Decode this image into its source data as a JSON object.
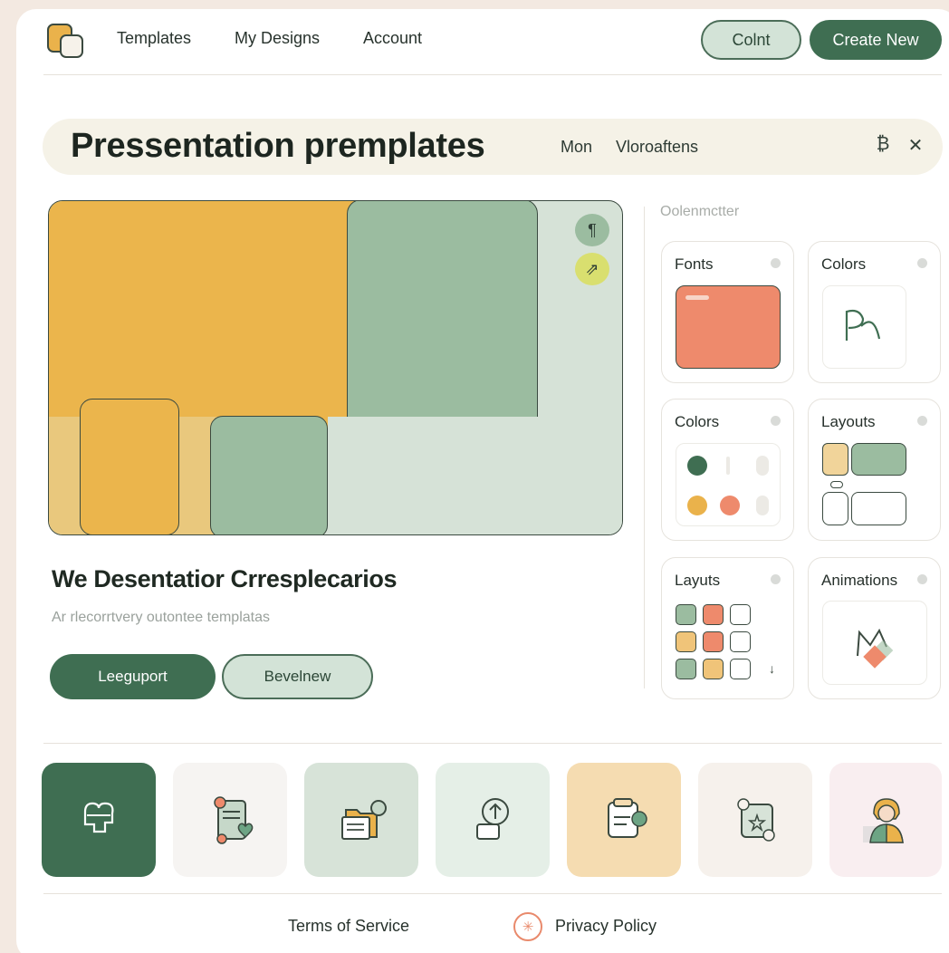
{
  "nav": {
    "links": [
      "Templates",
      "My Designs",
      "Account"
    ],
    "secondary_button": "Colnt",
    "primary_button": "Create New"
  },
  "titlebar": {
    "title": "Pressentation premplates",
    "links": [
      "Mon",
      "Vloroaftens"
    ]
  },
  "hero": {
    "title": "We Desentatior Crresplecarios",
    "subtitle": "Ar rlecorrtvery outontee templatas",
    "primary_button": "Leeguport",
    "secondary_button": "Bevelnew"
  },
  "panel": {
    "label": "Oolenmctter",
    "tiles": [
      "Fonts",
      "Colors",
      "Colors",
      "Layouts",
      "Layuts",
      "Animations"
    ]
  },
  "colors": {
    "accent_green": "#3f6e52",
    "mint": "#d3e3d7",
    "mustard": "#eab24b",
    "sage": "#9bbca0",
    "coral": "#ee8a6c"
  },
  "icons": [
    "heart-puzzle-icon",
    "document-heart-icon",
    "folder-icon",
    "lightbulb-icon",
    "clipboard-icon",
    "sticker-icon",
    "person-avatar-icon"
  ],
  "footer": {
    "terms": "Terms of Service",
    "privacy": "Privacy Policy"
  }
}
